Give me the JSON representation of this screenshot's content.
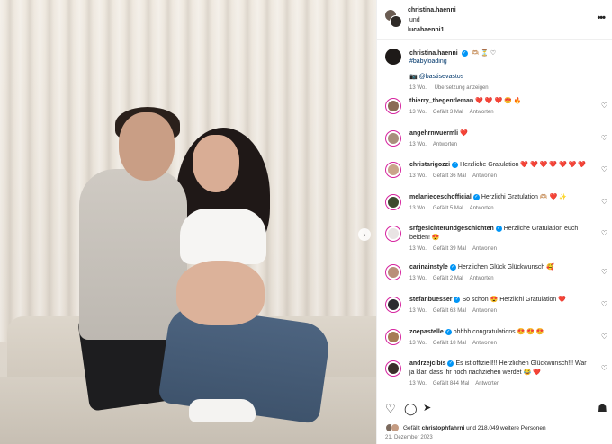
{
  "header": {
    "user1": "christina.haenni",
    "joiner": "und",
    "user2": "lucahaenni1"
  },
  "caption": {
    "username": "christina.haenni",
    "text": "🫶🏼 ⏳ ♡",
    "hashtag": "#babyloading",
    "mention_prefix": "📷",
    "mention": "@bastisevastos",
    "age": "13 Wo.",
    "translate": "Übersetzung anzeigen"
  },
  "comments": [
    {
      "username": "thierry_thegentleman",
      "verified": false,
      "text": "❤️ ❤️ ❤️ 😍 🔥",
      "age": "13 Wo.",
      "likes": "Gefällt 3 Mal",
      "reply": "Antworten",
      "color": "#8a6b55"
    },
    {
      "username": "angehrnwuermli",
      "verified": false,
      "text": "❤️",
      "age": "13 Wo.",
      "likes": "",
      "reply": "Antworten",
      "color": "#a88f7c"
    },
    {
      "username": "christarigozzi",
      "verified": true,
      "text": "Herzliche Gratulation ❤️ ❤️ ❤️ ❤️ ❤️ ❤️ ❤️",
      "age": "13 Wo.",
      "likes": "Gefällt 36 Mal",
      "reply": "Antworten",
      "color": "#c9a48a"
    },
    {
      "username": "melanieoeschofficial",
      "verified": true,
      "text": "Herzlichi Gratulation 🫶🏼 ❤️ ✨",
      "age": "13 Wo.",
      "likes": "Gefällt 5 Mal",
      "reply": "Antworten",
      "color": "#3d4a2f"
    },
    {
      "username": "srfgesichterundgeschichten",
      "verified": true,
      "text": "Herzliche Gratulation euch beiden! 😍",
      "age": "13 Wo.",
      "likes": "Gefällt 39 Mal",
      "reply": "Antworten",
      "color": "#e9e4e4"
    },
    {
      "username": "carinainstyle",
      "verified": true,
      "text": "Herzlichen Glück Glückwunsch 🥰",
      "age": "13 Wo.",
      "likes": "Gefällt 2 Mal",
      "reply": "Antworten",
      "color": "#b98f7a"
    },
    {
      "username": "stefanbuesser",
      "verified": true,
      "text": "So schön 😍 Herzlichi Gratulation ❤️",
      "age": "13 Wo.",
      "likes": "Gefällt 63 Mal",
      "reply": "Antworten",
      "color": "#2c2c30"
    },
    {
      "username": "zoepastelle",
      "verified": true,
      "text": "ohhhh congratulations 😍 😍 😍",
      "age": "13 Wo.",
      "likes": "Gefällt 18 Mal",
      "reply": "Antworten",
      "color": "#a67b55"
    },
    {
      "username": "andrzejcibis",
      "verified": true,
      "text": "Es ist offiziell!!! Herzlichen Glückwunsch!!! War ja klar, dass ihr noch nachziehen werdet 😂 ❤️",
      "age": "13 Wo.",
      "likes": "Gefällt 844 Mal",
      "reply": "Antworten",
      "color": "#3b2f2a"
    }
  ],
  "likes_summary": {
    "prefix": "Gefällt",
    "user": "christophfahrni",
    "suffix": "und 218.049 weitere Personen"
  },
  "date": "21. Dezember 2023",
  "icons": {
    "like": "heart-icon",
    "comment": "comment-icon",
    "share": "share-icon",
    "save": "bookmark-icon",
    "more": "more-icon",
    "carousel": "chevron-right-icon"
  },
  "colors": {
    "link": "#00376b",
    "verified": "#0095f6",
    "muted": "#737373",
    "story_ring": "#d6249f"
  }
}
